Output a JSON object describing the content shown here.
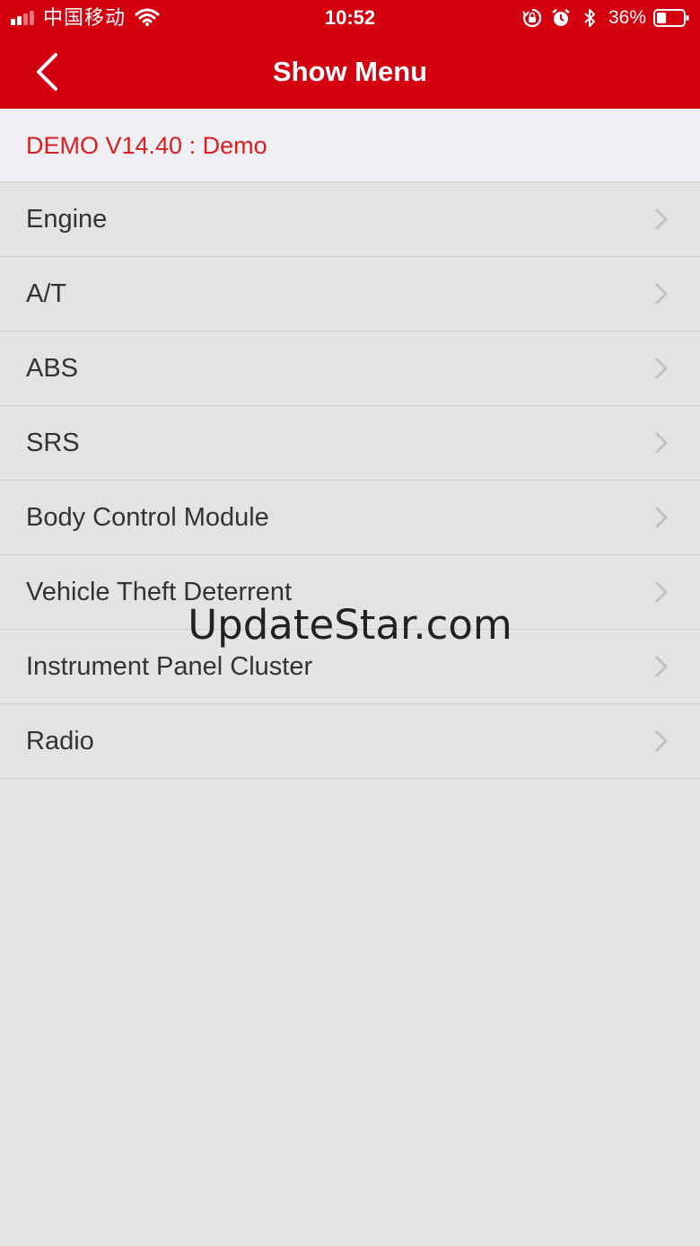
{
  "status_bar": {
    "carrier": "中国移动",
    "time": "10:52",
    "battery_percent": "36%",
    "battery_level": 0.36,
    "icons": [
      "signal-icon",
      "wifi-icon",
      "orientation-lock-icon",
      "alarm-icon",
      "bluetooth-icon",
      "battery-icon"
    ]
  },
  "nav": {
    "title": "Show Menu",
    "back_icon": "chevron-left-icon"
  },
  "header": {
    "label": "DEMO V14.40 : Demo"
  },
  "menu": {
    "items": [
      {
        "label": "Engine"
      },
      {
        "label": "A/T"
      },
      {
        "label": "ABS"
      },
      {
        "label": "SRS"
      },
      {
        "label": "Body Control Module"
      },
      {
        "label": "Vehicle Theft Deterrent"
      },
      {
        "label": "Instrument Panel Cluster"
      },
      {
        "label": "Radio"
      }
    ],
    "chevron_icon": "chevron-right-icon"
  },
  "watermark": "UpdateStar.com",
  "colors": {
    "accent": "#d40010",
    "header_text": "#d81e1e",
    "background": "#e3e3e3"
  }
}
